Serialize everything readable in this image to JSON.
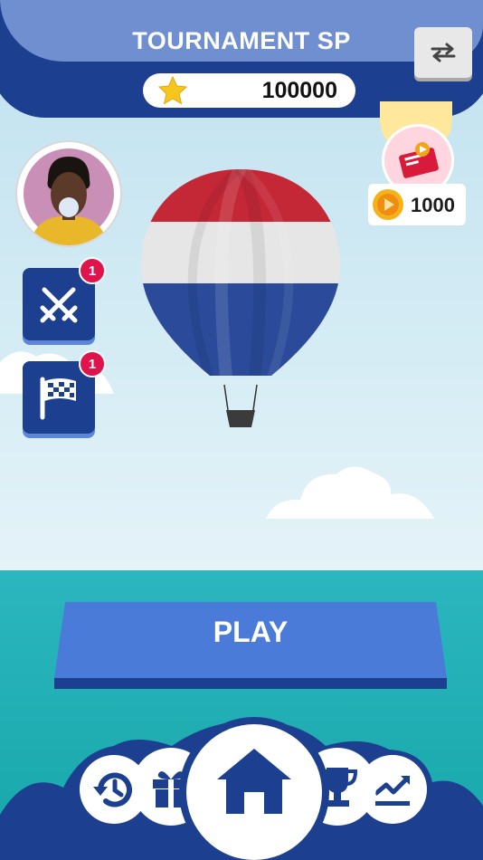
{
  "header": {
    "title": "TOURNAMENT SP",
    "stars_value": "100000"
  },
  "rewards": {
    "coins_value": "1000"
  },
  "side_buttons": {
    "battles_badge": "1",
    "race_badge": "1"
  },
  "play": {
    "label": "PLAY"
  },
  "nav": {
    "home_label": "HOME",
    "items": [
      "history-icon",
      "gift-icon",
      "home-icon",
      "trophy-icon",
      "stats-icon"
    ]
  },
  "colors": {
    "navy": "#1c3f8f",
    "header_light": "#6f8fd0",
    "play_blue": "#4a7bd9",
    "badge_red": "#e0144c",
    "sea": "#16a7a9"
  }
}
